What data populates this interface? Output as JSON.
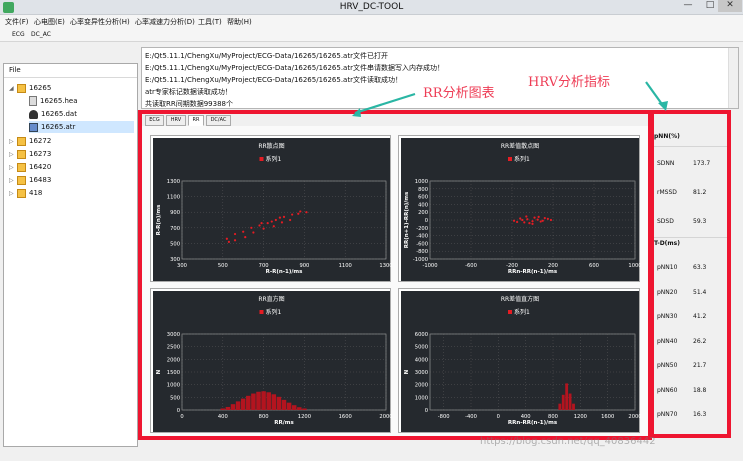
{
  "window": {
    "title": "HRV_DC-TOOL",
    "minimize": "—",
    "maximize": "□",
    "close": "✕"
  },
  "menu": [
    "文件(F)",
    "心电图(E)",
    "心率变异性分析(H)",
    "心率减速力分析(D)",
    "工具(T)",
    "帮助(H)"
  ],
  "toolbar": [
    "ECG",
    "DC_AC"
  ],
  "tree": {
    "header": "File",
    "root": "16265",
    "children": [
      "16265.hea",
      "16265.dat",
      "16265.atr"
    ],
    "others": [
      "16272",
      "16273",
      "16420",
      "16483",
      "418"
    ]
  },
  "log": [
    "E:/Qt5.11.1/ChengXu/MyProject/ECG-Data/16265/16265.atr文件已打开",
    "E:/Qt5.11.1/ChengXu/MyProject/ECG-Data/16265/16265.atr文件串请数据写入内存成功！",
    "E:/Qt5.11.1/ChengXu/MyProject/ECG-Data/16265/16265.atr文件读取成功！",
    "atr专家标记数据读取成功！",
    "共读取RR间期数据99388个"
  ],
  "tabs": [
    "ECG",
    "HRV",
    "RR",
    "DC/AC"
  ],
  "annotations": {
    "rr": "RR分析图表",
    "hrv": "HRV分析指标"
  },
  "hrv": {
    "group1": "pNN(%)",
    "time": [
      {
        "k": "SDNN",
        "v": "173.7"
      },
      {
        "k": "rMSSD",
        "v": "81.2"
      },
      {
        "k": "SDSD",
        "v": "59.3"
      }
    ],
    "group2": "T-D(ms)",
    "pnn": [
      {
        "k": "pNN10",
        "v": "63.3"
      },
      {
        "k": "pNN20",
        "v": "51.4"
      },
      {
        "k": "pNN30",
        "v": "41.2"
      },
      {
        "k": "pNN40",
        "v": "26.2"
      },
      {
        "k": "pNN50",
        "v": "21.7"
      },
      {
        "k": "pNN60",
        "v": "18.8"
      },
      {
        "k": "pNN70",
        "v": "16.3"
      }
    ]
  },
  "watermark": "https://blog.csdn.net/qq_40836442",
  "chart_data": [
    {
      "type": "scatter",
      "title": "RR散点图",
      "legend": "系列1",
      "xlabel": "R-R(n-1)/ms",
      "ylabel": "R-R(n)/ms",
      "xlim": [
        300,
        1300
      ],
      "ylim": [
        300,
        1300
      ],
      "xticks": [
        300,
        500,
        700,
        900,
        1100,
        1300
      ],
      "yticks": [
        300,
        500,
        700,
        900,
        1100,
        1300
      ],
      "points": [
        [
          520,
          560
        ],
        [
          560,
          620
        ],
        [
          600,
          650
        ],
        [
          640,
          700
        ],
        [
          680,
          730
        ],
        [
          720,
          760
        ],
        [
          760,
          800
        ],
        [
          800,
          840
        ],
        [
          840,
          870
        ],
        [
          880,
          910
        ],
        [
          650,
          640
        ],
        [
          700,
          690
        ],
        [
          750,
          720
        ],
        [
          790,
          770
        ],
        [
          830,
          800
        ],
        [
          610,
          580
        ],
        [
          560,
          540
        ],
        [
          530,
          520
        ],
        [
          870,
          880
        ],
        [
          910,
          900
        ],
        [
          740,
          780
        ],
        [
          780,
          830
        ],
        [
          690,
          760
        ]
      ]
    },
    {
      "type": "scatter",
      "title": "RR差值散点图",
      "legend": "系列1",
      "xlabel": "RRn-RR(n-1)/ms",
      "ylabel": "RR(n+1)-RR(n)/ms",
      "xlim": [
        -1000,
        1000
      ],
      "ylim": [
        -1000,
        1000
      ],
      "xticks": [
        -1000,
        -600,
        -200,
        200,
        600,
        1000
      ],
      "yticks": [
        -1000,
        -800,
        -600,
        -400,
        -200,
        0,
        200,
        400,
        600,
        800,
        1000
      ],
      "points": [
        [
          -150,
          -50
        ],
        [
          -100,
          0
        ],
        [
          -50,
          20
        ],
        [
          0,
          -30
        ],
        [
          50,
          10
        ],
        [
          100,
          -20
        ],
        [
          150,
          30
        ],
        [
          -120,
          40
        ],
        [
          -80,
          -60
        ],
        [
          20,
          60
        ],
        [
          80,
          -40
        ],
        [
          120,
          50
        ],
        [
          -30,
          -80
        ],
        [
          60,
          80
        ],
        [
          -60,
          90
        ],
        [
          0,
          -100
        ],
        [
          -180,
          -20
        ],
        [
          180,
          0
        ]
      ]
    },
    {
      "type": "bar",
      "title": "RR直方图",
      "legend": "系列1",
      "xlabel": "RR/ms",
      "ylabel": "N",
      "xlim": [
        0,
        2000
      ],
      "ylim": [
        0,
        3000
      ],
      "xticks": [
        0,
        400,
        800,
        1200,
        1600,
        2000
      ],
      "yticks": [
        0,
        500,
        1000,
        1500,
        2000,
        2500,
        3000
      ],
      "bins": [
        [
          400,
          60
        ],
        [
          450,
          120
        ],
        [
          500,
          230
        ],
        [
          550,
          340
        ],
        [
          600,
          450
        ],
        [
          650,
          560
        ],
        [
          700,
          650
        ],
        [
          750,
          720
        ],
        [
          800,
          740
        ],
        [
          850,
          700
        ],
        [
          900,
          620
        ],
        [
          950,
          520
        ],
        [
          1000,
          400
        ],
        [
          1050,
          290
        ],
        [
          1100,
          190
        ],
        [
          1150,
          110
        ],
        [
          1200,
          60
        ]
      ]
    },
    {
      "type": "bar",
      "title": "RR差值直方图",
      "legend": "系列1",
      "xlabel": "RRn-RR(n-1)/ms",
      "ylabel": "N",
      "xlim": [
        -1000,
        2000
      ],
      "ylim": [
        0,
        6000
      ],
      "xticks": [
        -800,
        -400,
        0,
        400,
        800,
        1200,
        1600,
        2000
      ],
      "yticks": [
        0,
        1000,
        2000,
        3000,
        4000,
        5000,
        6000
      ],
      "bins": [
        [
          900,
          500
        ],
        [
          950,
          1200
        ],
        [
          1000,
          2100
        ],
        [
          1050,
          1300
        ],
        [
          1100,
          500
        ]
      ]
    }
  ]
}
